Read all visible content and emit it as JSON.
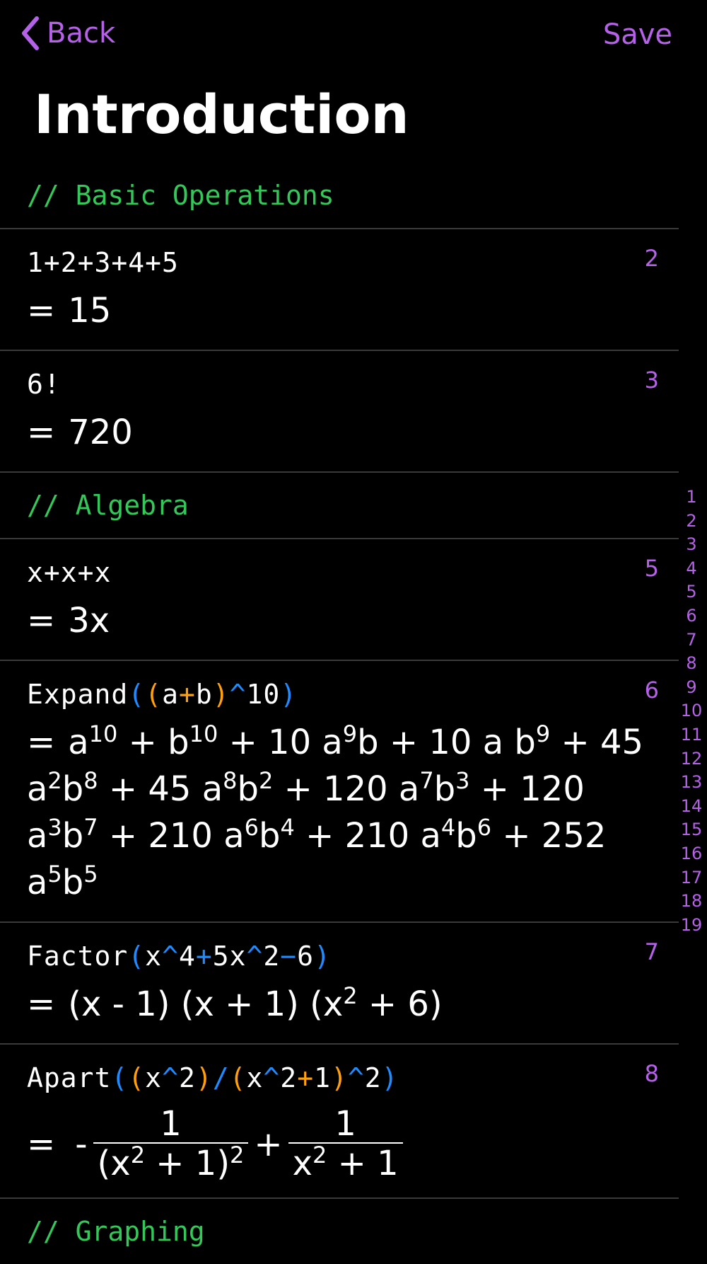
{
  "nav": {
    "back_label": "Back",
    "save_label": "Save"
  },
  "title": "Introduction",
  "sections": {
    "basic": "// Basic Operations",
    "algebra": "// Algebra",
    "graphing": "// Graphing"
  },
  "cells": [
    {
      "line": "2",
      "input": "1+2+3+4+5",
      "result": "15"
    },
    {
      "line": "3",
      "input": "6!",
      "result": "720"
    },
    {
      "line": "5",
      "input": "x+x+x",
      "result": "3x"
    },
    {
      "line": "6",
      "input_parts": [
        "Expand",
        "(",
        "(",
        "a",
        "+",
        "b",
        ")",
        "^",
        "10",
        ")"
      ],
      "result_terms": [
        "a",
        "10",
        "+ b",
        "10",
        "+ 10 a",
        "9",
        "b + 10 a b",
        "9",
        "+ 45 a",
        "2",
        "b",
        "8",
        "+ 45 a",
        "8",
        "b",
        "2",
        "+ 120 a",
        "7",
        "b",
        "3",
        "+ 120 a",
        "3",
        "b",
        "7",
        "+ 210 a",
        "6",
        "b",
        "4",
        "+ 210 a",
        "4",
        "b",
        "6",
        "+ 252 a",
        "5",
        "b",
        "5"
      ]
    },
    {
      "line": "7",
      "input_parts": [
        "Factor",
        "(",
        "x",
        "^",
        "4",
        "+",
        "5x",
        "^",
        "2",
        "−",
        "6",
        ")"
      ],
      "result_parts": [
        "(x - 1) (x + 1) (x",
        "2",
        "+ 6)"
      ]
    },
    {
      "line": "8",
      "input_parts": [
        "Apart",
        "(",
        "(",
        "x",
        "^",
        "2",
        ")",
        "/",
        "(",
        "x",
        "^",
        "2",
        "+",
        "1",
        ")",
        "^",
        "2",
        ")"
      ],
      "result": {
        "sign": "-",
        "frac1_num": "1",
        "frac1_den": [
          "(x",
          "2",
          " + 1)",
          "2"
        ],
        "plus": "+",
        "frac2_num": "1",
        "frac2_den": [
          "x",
          "2",
          " + 1"
        ]
      }
    }
  ],
  "equals": "=",
  "index": [
    "1",
    "2",
    "3",
    "4",
    "5",
    "6",
    "7",
    "8",
    "9",
    "10",
    "11",
    "12",
    "13",
    "14",
    "15",
    "16",
    "17",
    "18",
    "19"
  ],
  "colors": {
    "accent": "#b561e8",
    "comment": "#34c759",
    "bracket_blue": "#1e8bff",
    "bracket_orange": "#ff9f0a"
  }
}
